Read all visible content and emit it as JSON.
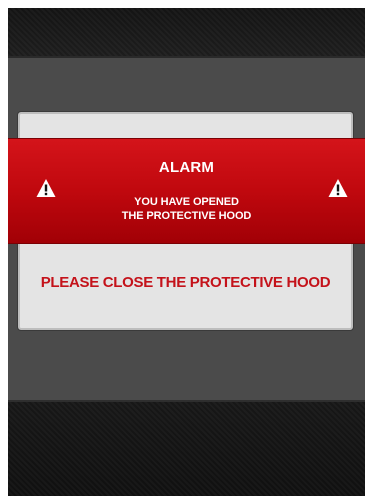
{
  "alarm": {
    "title": "ALARM",
    "message_line1": "YOU HAVE OPENED",
    "message_line2": "THE PROTECTIVE HOOD",
    "icon": "warning-triangle-icon",
    "band_color": "#c0080e"
  },
  "dialog": {
    "instruction": "PLEASE CLOSE THE PROTECTIVE HOOD",
    "instruction_color": "#c4121a",
    "background_color": "#e4e4e4"
  }
}
